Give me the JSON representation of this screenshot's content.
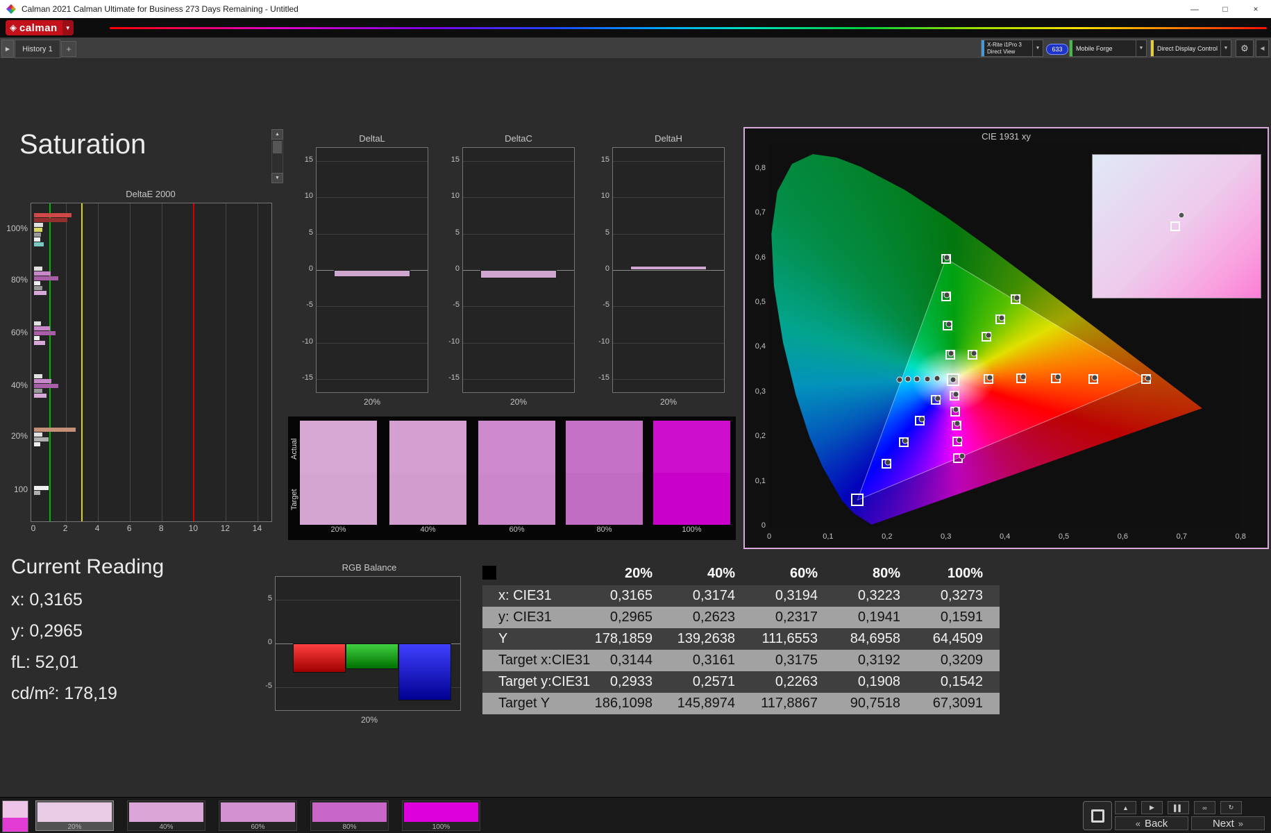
{
  "window": {
    "title": "Calman 2021 Calman Ultimate for Business 273 Days Remaining  - Untitled"
  },
  "icons": {
    "minimize": "—",
    "maximize": "□",
    "close": "×",
    "dropdown_small": "▼",
    "gear": "⚙",
    "plus": "+",
    "tab_arrow": "▶",
    "up_arrow": "▲",
    "down_arrow": "▼",
    "left_arrow": "◀",
    "back_chevrons": "«",
    "next_chevrons": "»",
    "logo_diamond": "◈"
  },
  "logo": {
    "text": "calman"
  },
  "tabs": {
    "history": "History 1"
  },
  "toolbar": {
    "device": {
      "line1": "X-Rite i1Pro 3",
      "line2": "Direct View",
      "edge_color": "#4898d8"
    },
    "badge": "633",
    "source": "Mobile Forge",
    "source_edge_color": "#48b848",
    "control": "Direct Display Control",
    "control_edge_color": "#e0d040"
  },
  "page": {
    "heading": "Saturation"
  },
  "charts": {
    "deltae": {
      "type": "bar",
      "title": "DeltaE 2000",
      "xticks": [
        0,
        2,
        4,
        6,
        8,
        10,
        12,
        14
      ],
      "xmax": 14.5,
      "ref_lines": [
        {
          "value": 1,
          "color": "#00b400"
        },
        {
          "value": 3,
          "color": "#d8d800"
        },
        {
          "value": 10,
          "color": "#d00000"
        }
      ],
      "groups": [
        {
          "label": "100%",
          "bars": [
            {
              "color": "#d04848",
              "value": 2.35
            },
            {
              "color": "#952e2e",
              "value": 2.1
            },
            {
              "color": "#e0e0e0",
              "value": 0.55
            },
            {
              "color": "#d8d860",
              "value": 0.5
            },
            {
              "color": "#989898",
              "value": 0.45
            },
            {
              "color": "#f0f0f0",
              "value": 0.4
            },
            {
              "color": "#78c8c8",
              "value": 0.6
            }
          ]
        },
        {
          "label": "80%",
          "bars": [
            {
              "color": "#e0e0e0",
              "value": 0.5
            },
            {
              "color": "#c887c8",
              "value": 1.05
            },
            {
              "color": "#a85fa8",
              "value": 1.5
            },
            {
              "color": "#f0f0f0",
              "value": 0.4
            },
            {
              "color": "#989898",
              "value": 0.5
            },
            {
              "color": "#d8a8d8",
              "value": 0.8
            }
          ]
        },
        {
          "label": "60%",
          "bars": [
            {
              "color": "#e0e0e0",
              "value": 0.45
            },
            {
              "color": "#c887c8",
              "value": 1.0
            },
            {
              "color": "#a85fa8",
              "value": 1.35
            },
            {
              "color": "#f0f0f0",
              "value": 0.35
            },
            {
              "color": "#d8a8d8",
              "value": 0.7
            }
          ]
        },
        {
          "label": "40%",
          "bars": [
            {
              "color": "#e0e0e0",
              "value": 0.5
            },
            {
              "color": "#c887c8",
              "value": 1.1
            },
            {
              "color": "#a85fa8",
              "value": 1.5
            },
            {
              "color": "#989898",
              "value": 0.5
            },
            {
              "color": "#d8a8d8",
              "value": 0.8
            }
          ]
        },
        {
          "label": "20%",
          "bars": [
            {
              "color": "#c49078",
              "value": 2.6
            },
            {
              "color": "#e0e0e0",
              "value": 0.5
            },
            {
              "color": "#b0b0b0",
              "value": 0.9
            },
            {
              "color": "#f0f0f0",
              "value": 0.4
            }
          ]
        },
        {
          "label": "100",
          "bars": [
            {
              "color": "#f0f0f0",
              "value": 0.9
            },
            {
              "color": "#b0b0b0",
              "value": 0.4
            }
          ]
        }
      ]
    },
    "deltal": {
      "type": "bar",
      "title": "DeltaL",
      "category": "20%",
      "value": -1.0,
      "yticks": [
        15,
        10,
        5,
        0,
        -5,
        -10,
        -15
      ],
      "bar_color": "#cfa6cf"
    },
    "deltac": {
      "type": "bar",
      "title": "DeltaC",
      "category": "20%",
      "value": -1.1,
      "yticks": [
        15,
        10,
        5,
        0,
        -5,
        -10,
        -15
      ],
      "bar_color": "#cfa6cf"
    },
    "deltah": {
      "type": "bar",
      "title": "DeltaH",
      "category": "20%",
      "value": 0.6,
      "yticks": [
        15,
        10,
        5,
        0,
        -5,
        -10,
        -15
      ],
      "bar_color": "#cfa6cf"
    },
    "rgb": {
      "type": "bar",
      "title": "RGB Balance",
      "category": "20%",
      "yticks": [
        5,
        0,
        -5
      ],
      "series": [
        {
          "name": "Red",
          "value": -3.3,
          "color_top": "#ff4040",
          "color_bottom": "#a00000"
        },
        {
          "name": "Green",
          "value": -2.9,
          "color_top": "#40d040",
          "color_bottom": "#007000"
        },
        {
          "name": "Blue",
          "value": -6.5,
          "color_top": "#4040ff",
          "color_bottom": "#000090"
        }
      ]
    },
    "cie": {
      "type": "scatter",
      "title": "CIE 1931 xy",
      "xticks": [
        "0",
        "0,1",
        "0,2",
        "0,3",
        "0,4",
        "0,5",
        "0,6",
        "0,7",
        "0,8"
      ],
      "yticks": [
        "0,8",
        "0,7",
        "0,6",
        "0,5",
        "0,4",
        "0,3",
        "0,2",
        "0,1",
        "0"
      ],
      "srgb_triangle": [
        [
          0.64,
          0.33
        ],
        [
          0.3,
          0.6
        ],
        [
          0.15,
          0.06
        ]
      ],
      "targets": [
        [
          0.3127,
          0.329
        ],
        [
          0.3144,
          0.2933
        ],
        [
          0.3161,
          0.2571
        ],
        [
          0.3175,
          0.2263
        ],
        [
          0.3192,
          0.1908
        ],
        [
          0.3209,
          0.1542
        ],
        [
          0.307,
          0.385
        ],
        [
          0.303,
          0.45
        ],
        [
          0.3,
          0.515
        ],
        [
          0.3,
          0.6
        ],
        [
          0.345,
          0.385
        ],
        [
          0.369,
          0.425
        ],
        [
          0.392,
          0.465
        ],
        [
          0.418,
          0.51
        ],
        [
          0.372,
          0.331
        ],
        [
          0.428,
          0.332
        ],
        [
          0.487,
          0.332
        ],
        [
          0.55,
          0.331
        ],
        [
          0.64,
          0.33
        ],
        [
          0.283,
          0.284
        ],
        [
          0.256,
          0.237
        ],
        [
          0.228,
          0.19
        ],
        [
          0.199,
          0.142
        ],
        [
          0.15,
          0.06
        ]
      ],
      "measurements": [
        [
          0.3165,
          0.2965
        ],
        [
          0.3174,
          0.2623
        ],
        [
          0.3194,
          0.2317
        ],
        [
          0.3223,
          0.1941
        ],
        [
          0.3273,
          0.1591
        ],
        [
          0.309,
          0.388
        ],
        [
          0.305,
          0.453
        ],
        [
          0.302,
          0.518
        ],
        [
          0.302,
          0.603
        ],
        [
          0.347,
          0.388
        ],
        [
          0.372,
          0.428
        ],
        [
          0.395,
          0.468
        ],
        [
          0.421,
          0.513
        ],
        [
          0.375,
          0.334
        ],
        [
          0.431,
          0.335
        ],
        [
          0.49,
          0.335
        ],
        [
          0.553,
          0.334
        ],
        [
          0.643,
          0.333
        ],
        [
          0.286,
          0.287
        ],
        [
          0.259,
          0.24
        ],
        [
          0.231,
          0.193
        ],
        [
          0.202,
          0.145
        ],
        [
          0.285,
          0.332
        ],
        [
          0.268,
          0.331
        ],
        [
          0.251,
          0.33
        ],
        [
          0.236,
          0.33
        ],
        [
          0.222,
          0.329
        ],
        [
          0.3127,
          0.329
        ]
      ],
      "inset": {
        "circle": [
          0.53,
          0.42
        ],
        "square": [
          0.49,
          0.5
        ]
      }
    }
  },
  "swatches": {
    "row_labels": [
      "Actual",
      "Target"
    ],
    "items": [
      {
        "label": "20%",
        "actual": "#d6a8d3",
        "target": "#d4a5d1"
      },
      {
        "label": "40%",
        "actual": "#d3a0d1",
        "target": "#d19dcf"
      },
      {
        "label": "60%",
        "actual": "#cd8bcd",
        "target": "#ca87ca"
      },
      {
        "label": "80%",
        "actual": "#c571c7",
        "target": "#c26dc4"
      },
      {
        "label": "100%",
        "actual": "#cd0ecd",
        "target": "#c900c9"
      }
    ]
  },
  "current_reading": {
    "heading": "Current Reading",
    "lines": [
      "x: 0,3165",
      "y: 0,2965",
      "fL: 52,01",
      "cd/m²: 178,19"
    ]
  },
  "table": {
    "columns": [
      "20%",
      "40%",
      "60%",
      "80%",
      "100%"
    ],
    "rows": [
      {
        "label": "x: CIE31",
        "values": [
          "0,3165",
          "0,3174",
          "0,3194",
          "0,3223",
          "0,3273"
        ]
      },
      {
        "label": "y: CIE31",
        "values": [
          "0,2965",
          "0,2623",
          "0,2317",
          "0,1941",
          "0,1591"
        ]
      },
      {
        "label": "Y",
        "values": [
          "178,1859",
          "139,2638",
          "111,6553",
          "84,6958",
          "64,4509"
        ]
      },
      {
        "label": "Target x:CIE31",
        "values": [
          "0,3144",
          "0,3161",
          "0,3175",
          "0,3192",
          "0,3209"
        ]
      },
      {
        "label": "Target y:CIE31",
        "values": [
          "0,2933",
          "0,2571",
          "0,2263",
          "0,1908",
          "0,1542"
        ]
      },
      {
        "label": "Target Y",
        "values": [
          "186,1098",
          "145,8974",
          "117,8867",
          "90,7518",
          "67,3091"
        ]
      }
    ]
  },
  "bottom_bar": {
    "patches": [
      {
        "label": "20%",
        "color": "#e8cbe4",
        "selected": true
      },
      {
        "label": "40%",
        "color": "#daa6d8",
        "selected": false
      },
      {
        "label": "60%",
        "color": "#d391d1",
        "selected": false
      },
      {
        "label": "80%",
        "color": "#c867c8",
        "selected": false
      },
      {
        "label": "100%",
        "color": "#dd00dd",
        "selected": false
      }
    ],
    "transport": [
      {
        "name": "eject-button",
        "icon": "▲"
      },
      {
        "name": "play-button",
        "icon": "▶"
      },
      {
        "name": "pause-button",
        "icon": "▌▌"
      },
      {
        "name": "loop-button",
        "icon": "∞"
      },
      {
        "name": "refresh-button",
        "icon": "↻"
      }
    ],
    "back": "Back",
    "next": "Next"
  }
}
